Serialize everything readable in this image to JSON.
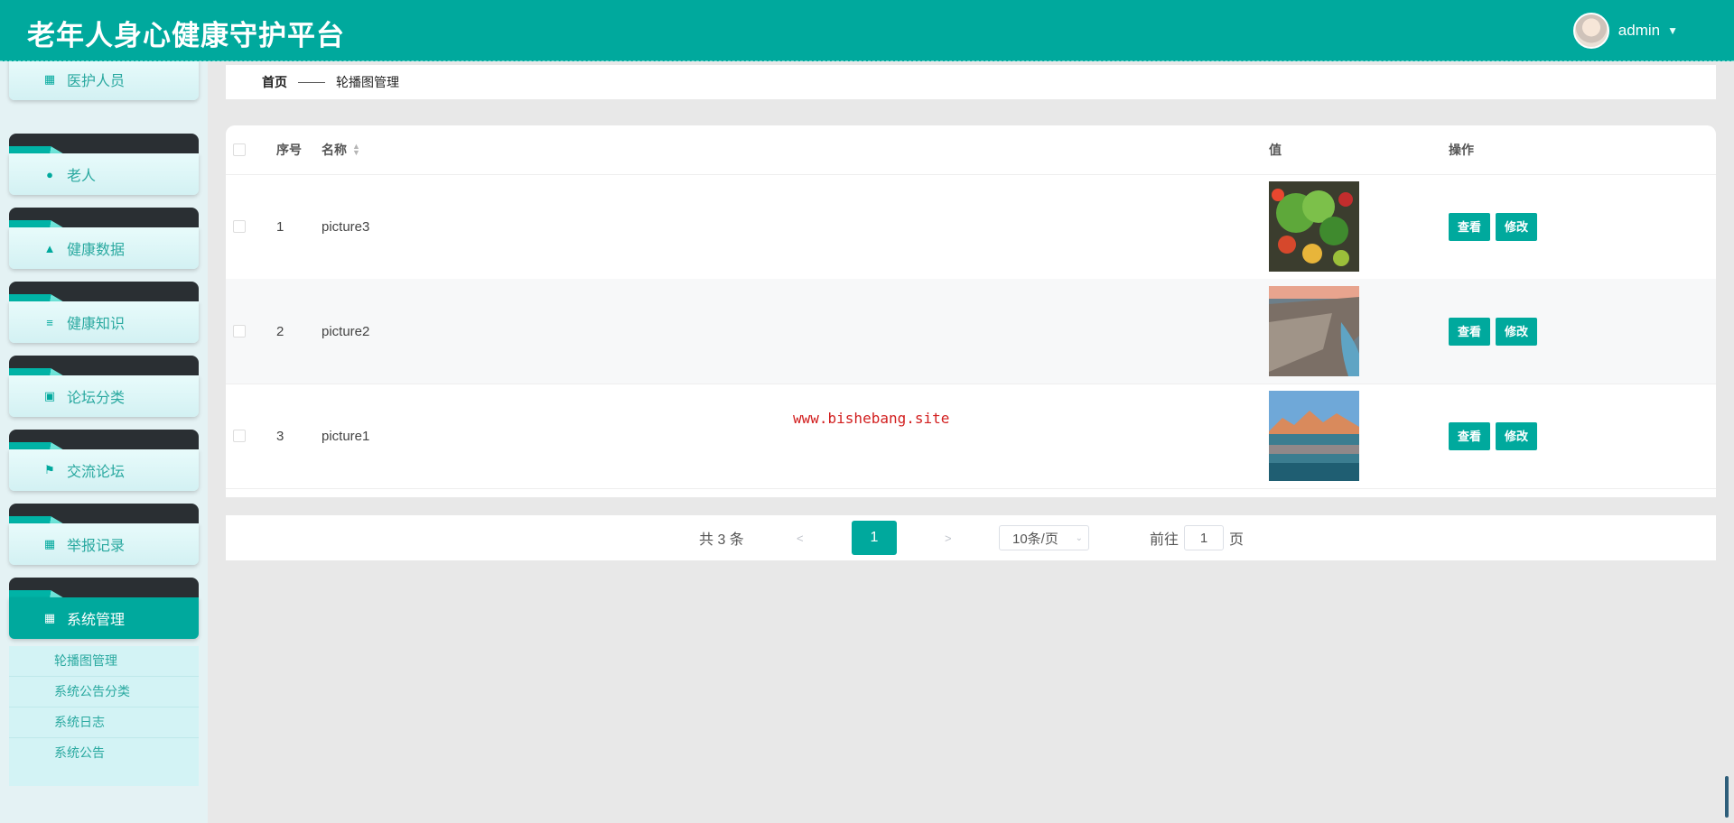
{
  "app": {
    "title": "老年人身心健康守护平台"
  },
  "user": {
    "name": "admin"
  },
  "sidebar": {
    "items": [
      {
        "label": "医护人员",
        "icon": "grid-icon"
      },
      {
        "label": "老人",
        "icon": "user-icon"
      },
      {
        "label": "健康数据",
        "icon": "person-icon"
      },
      {
        "label": "健康知识",
        "icon": "list-icon"
      },
      {
        "label": "论坛分类",
        "icon": "clipboard-icon"
      },
      {
        "label": "交流论坛",
        "icon": "flag-icon"
      },
      {
        "label": "举报记录",
        "icon": "grid-icon"
      },
      {
        "label": "系统管理",
        "icon": "grid-icon",
        "active": true
      }
    ],
    "submenu": [
      "轮播图管理",
      "系统公告分类",
      "系统日志",
      "系统公告"
    ]
  },
  "breadcrumb": {
    "home": "首页",
    "current": "轮播图管理"
  },
  "table": {
    "headers": {
      "index": "序号",
      "name": "名称",
      "value": "值",
      "actions": "操作"
    },
    "rows": [
      {
        "index": "1",
        "name": "picture3",
        "image": "vegetables"
      },
      {
        "index": "2",
        "name": "picture2",
        "image": "coastline"
      },
      {
        "index": "3",
        "name": "picture1",
        "image": "lake-mountains"
      }
    ],
    "view_label": "查看",
    "edit_label": "修改"
  },
  "watermark": "www.bishebang.site",
  "pagination": {
    "total_text": "共 3 条",
    "prev": "<",
    "current_page": "1",
    "next": ">",
    "page_size": "10条/页",
    "goto_prefix": "前往",
    "goto_value": "1",
    "goto_suffix": "页"
  },
  "colors": {
    "primary": "#00a99d",
    "header_bg": "#00a99d",
    "sidebar_bg": "#e4f2f4"
  }
}
